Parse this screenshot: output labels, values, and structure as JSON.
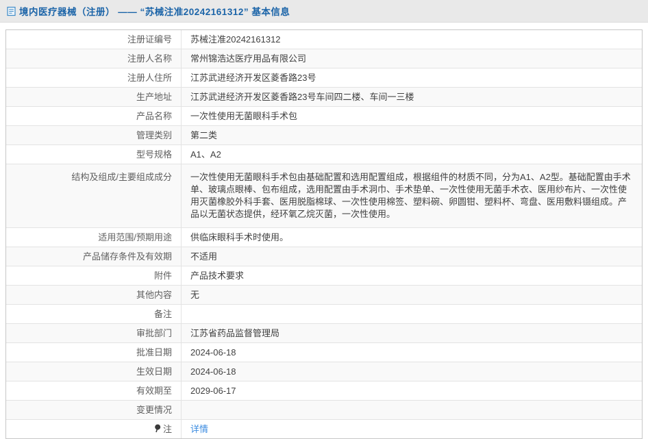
{
  "header": {
    "title": "境内医疗器械（注册） —— “苏械注准20242161312” 基本信息",
    "title_color": "#1b64a8",
    "doc_icon": "document-icon"
  },
  "colors": {
    "header_band_bg": "#e9e9e9",
    "row_alt_bg": "#f9f9f9",
    "table_border": "#c6c6c6",
    "inner_border": "#e3e3e3",
    "label_text": "#5f5f5f",
    "value_text": "#404040",
    "link_blue": "#3b8ce0",
    "title_blue": "#1b64a8"
  },
  "table": {
    "rows": [
      {
        "label": "注册证编号",
        "value": "苏械注准20242161312"
      },
      {
        "label": "注册人名称",
        "value": "常州锦浩达医疗用品有限公司"
      },
      {
        "label": "注册人住所",
        "value": "江苏武进经济开发区菱香路23号"
      },
      {
        "label": "生产地址",
        "value": "江苏武进经济开发区菱香路23号车间四二楼、车间一三楼"
      },
      {
        "label": "产品名称",
        "value": "一次性使用无菌眼科手术包"
      },
      {
        "label": "管理类别",
        "value": "第二类"
      },
      {
        "label": "型号规格",
        "value": "A1、A2"
      },
      {
        "label": "结构及组成/主要组成成分",
        "value": "一次性使用无菌眼科手术包由基础配置和选用配置组成，根据组件的材质不同，分为A1、A2型。基础配置由手术单、玻璃点眼棒、包布组成，选用配置由手术洞巾、手术垫单、一次性使用无菌手术衣、医用纱布片、一次性使用灭菌橡胶外科手套、医用脱脂棉球、一次性使用棉签、塑料碗、卵圆钳、塑料杯、弯盘、医用敷料镊组成。产品以无菌状态提供，经环氧乙烷灭菌，一次性使用。",
        "multiline": true
      },
      {
        "label": "适用范围/预期用途",
        "value": "供临床眼科手术时使用。"
      },
      {
        "label": "产品储存条件及有效期",
        "value": "不适用"
      },
      {
        "label": "附件",
        "value": "产品技术要求"
      },
      {
        "label": "其他内容",
        "value": "无"
      },
      {
        "label": "备注",
        "value": ""
      },
      {
        "label": "审批部门",
        "value": "江苏省药品监督管理局"
      },
      {
        "label": "批准日期",
        "value": "2024-06-18"
      },
      {
        "label": "生效日期",
        "value": "2024-06-18"
      },
      {
        "label": "有效期至",
        "value": "2029-06-17"
      },
      {
        "label": "变更情况",
        "value": ""
      },
      {
        "label": "注",
        "label_icon": "note-pin-icon",
        "value_link": "详情"
      }
    ]
  }
}
